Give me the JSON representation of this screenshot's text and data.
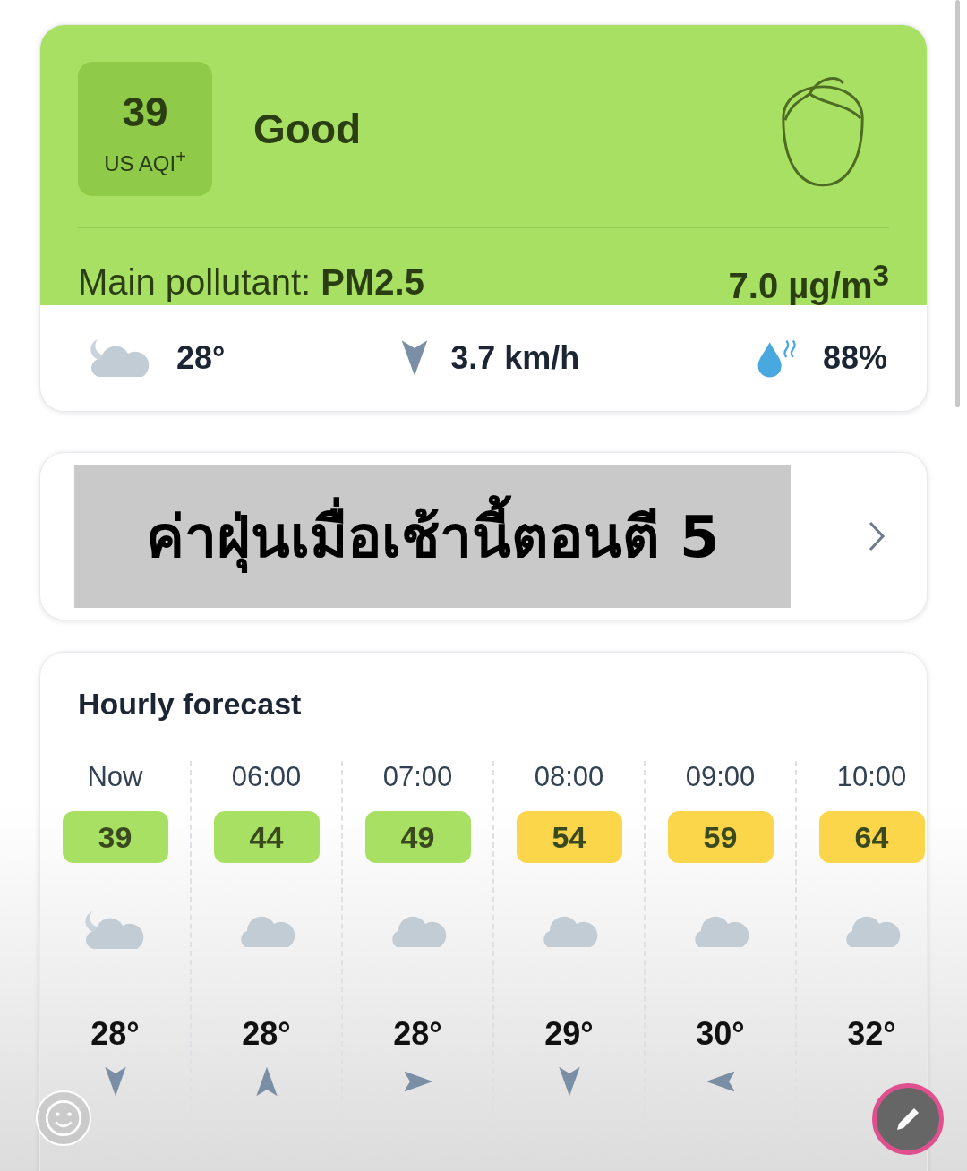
{
  "aqi_card": {
    "value": "39",
    "unit": "US AQI$^{+}$",
    "status": "Good",
    "pollutant": "Main pollutant: **PM2.5**",
    "concentration": "7.0 µg/m$^{3}$"
  },
  "weather": {
    "kind": "night-cloudy",
    "temperature": "28°",
    "wind": {
      "kind": "south"
    },
    "wind_speed": "3.7 km/h",
    "humidity": "88%"
  },
  "caption": "ค่าฝุ่นเมื่อเช้านี้ตอนตี 5",
  "hourly": {
    "title": "Hourly forecast",
    "hours": [
      {
        "time": "Now",
        "aqi": "39",
        "color": "#a8e063",
        "kind": "night-cloudy",
        "temperature": "28°",
        "wind": {
          "kind": "south"
        }
      },
      {
        "time": "06:00",
        "aqi": "44",
        "color": "#a8e063",
        "kind": "cloudy",
        "temperature": "28°",
        "wind": {
          "kind": "north"
        }
      },
      {
        "time": "07:00",
        "aqi": "49",
        "color": "#a8e063",
        "kind": "cloudy",
        "temperature": "28°",
        "wind": {
          "kind": "east"
        }
      },
      {
        "time": "08:00",
        "aqi": "54",
        "color": "#fbd54a",
        "kind": "cloudy",
        "temperature": "29°",
        "wind": {
          "kind": "south"
        }
      },
      {
        "time": "09:00",
        "aqi": "59",
        "color": "#fbd54a",
        "kind": "cloudy",
        "temperature": "30°",
        "wind": {
          "kind": "west"
        }
      },
      {
        "time": "10:00",
        "aqi": "64",
        "color": "#fbd54a",
        "kind": "cloudy",
        "temperature": "32°"
      }
    ]
  }
}
